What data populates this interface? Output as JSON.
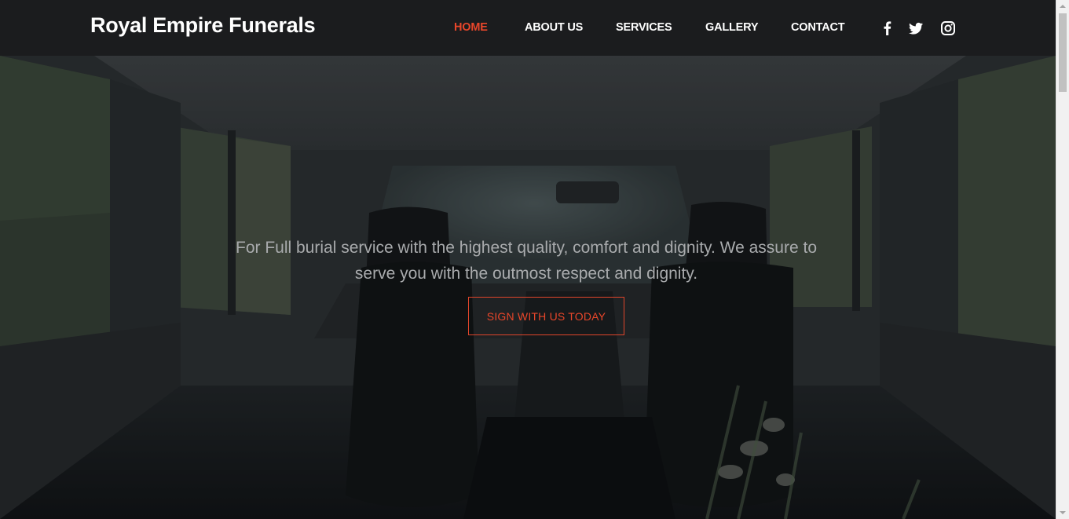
{
  "header": {
    "brand": "Royal Empire Funerals",
    "nav": {
      "home": "HOME",
      "about": "ABOUT US",
      "services": "SERVICES",
      "gallery": "GALLERY",
      "contact": "CONTACT"
    },
    "active_item": "HOME",
    "social_icons": [
      "facebook-icon",
      "twitter-icon",
      "instagram-icon"
    ]
  },
  "hero": {
    "tagline": "For Full burial service with the highest quality, comfort and dignity. We assure to serve you with the outmost respect and dignity.",
    "cta_label": "SIGN WITH US TODAY"
  },
  "colors": {
    "header_bg": "#1b1c1e",
    "accent": "#e8462a",
    "nav_text": "#ffffff",
    "hero_text": "#a9abad"
  }
}
